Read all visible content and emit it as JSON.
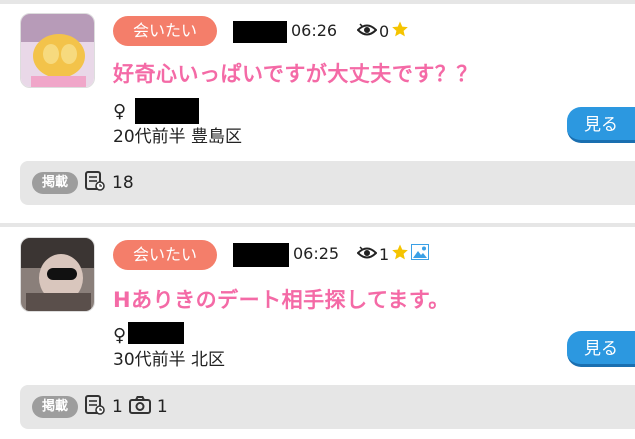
{
  "posts": [
    {
      "tag": "会いたい",
      "time": "06:26",
      "views": "0",
      "has_image_icon": false,
      "title": "好奇心いっぱいですが大丈夫です？？",
      "gender": "♀",
      "age_area": "20代前半 豊島区",
      "view_button": "見る",
      "footer_badge": "掲載",
      "board_count": "18",
      "photo_count": null
    },
    {
      "tag": "会いたい",
      "time": "06:25",
      "views": "1",
      "has_image_icon": true,
      "title": "Hありきのデート相手探してます。",
      "gender": "♀",
      "age_area": "30代前半 北区",
      "view_button": "見る",
      "footer_badge": "掲載",
      "board_count": "1",
      "photo_count": "1"
    }
  ],
  "colors": {
    "tag_bg": "#f47e6a",
    "title": "#f46aa6",
    "button": "#2c98e0",
    "star": "#f5c400",
    "image_icon": "#3aa0e6"
  },
  "icons": [
    "eye-icon",
    "star-icon",
    "image-icon",
    "document-icon",
    "camera-icon"
  ]
}
